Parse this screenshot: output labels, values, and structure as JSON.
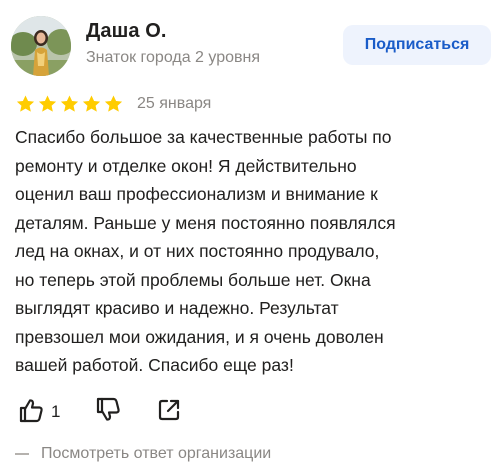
{
  "author": {
    "name": "Даша О.",
    "level": "Знаток города 2 уровня"
  },
  "subscribe_button": {
    "label": "Подписаться"
  },
  "rating": {
    "stars": 5,
    "max": 5,
    "date": "25 января"
  },
  "review": {
    "text": "Спасибо большое за качественные работы по\nремонту и отделке окон! Я действительно\nоценил ваш профессионализм и внимание к\nдеталям. Раньше у меня постоянно появлялся\nлед на окнах, и от них постоянно продувало,\nно теперь этой проблемы больше нет. Окна\nвыглядят красиво и надежно. Результат\nпревзошел мои ожидания, и я очень доволен\nвашей работой. Спасибо еще раз!"
  },
  "actions": {
    "likes": "1"
  },
  "org_reply": {
    "label": "Посмотреть ответ организации"
  },
  "colors": {
    "star": "#fc0",
    "accent": "#1a5cc8",
    "button_bg": "#eef3fd",
    "muted_text": "#8a8784"
  }
}
